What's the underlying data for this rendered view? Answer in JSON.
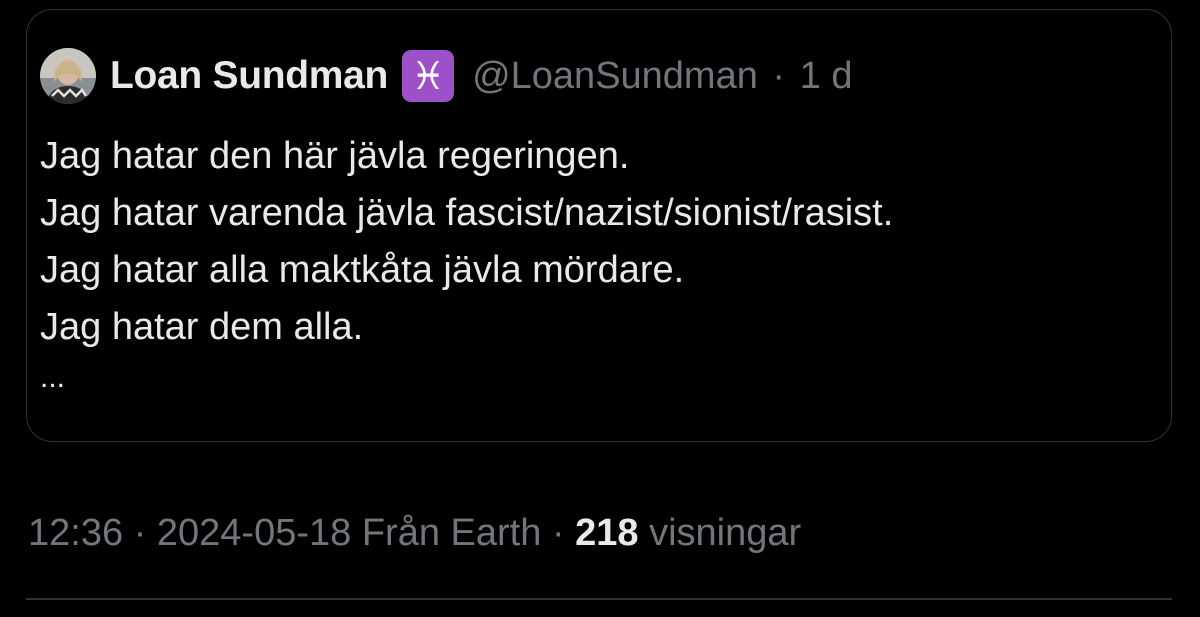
{
  "quoted_tweet": {
    "author_name": "Loan Sundman",
    "badge_symbol": "♓",
    "badge_color": "#9d50c8",
    "handle": "@LoanSundman",
    "separator": "·",
    "age": "1 d",
    "lines": [
      "Jag hatar den här jävla regeringen.",
      "Jag hatar varenda jävla fascist/nazist/sionist/rasist.",
      "Jag hatar alla maktkåta jävla mördare.",
      "Jag hatar dem alla."
    ],
    "truncation": "..."
  },
  "tweet_meta": {
    "time": "12:36",
    "separator": "·",
    "date": "2024-05-18",
    "source": "Från Earth",
    "views_count": "218",
    "views_label": "visningar"
  },
  "colors": {
    "background": "#000000",
    "primary_text": "#e7e9ea",
    "secondary_text": "#71767b",
    "border": "#2f3336"
  }
}
